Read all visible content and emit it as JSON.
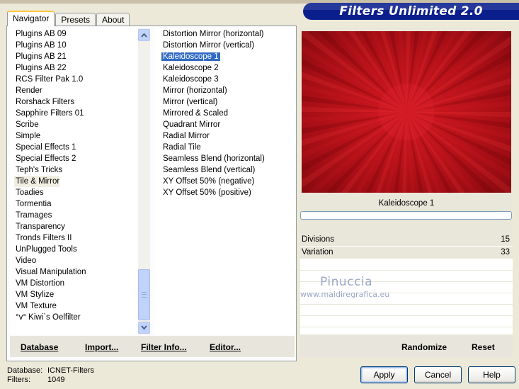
{
  "app": {
    "title": "Filters Unlimited 2.0"
  },
  "tabs": [
    {
      "label": "Navigator",
      "active": true
    },
    {
      "label": "Presets"
    },
    {
      "label": "About"
    }
  ],
  "categories": {
    "items": [
      "Plugins AB 09",
      "Plugins AB 10",
      "Plugins AB 21",
      "Plugins AB 22",
      "RCS Filter Pak 1.0",
      "Render",
      "Rorshack Filters",
      "Sapphire Filters 01",
      "Scribe",
      "Simple",
      "Special Effects 1",
      "Special Effects 2",
      "Teph's Tricks",
      "Tile & Mirror",
      "Toadies",
      "Tormentia",
      "Tramages",
      "Transparency",
      "Tronds Filters II",
      "UnPlugged Tools",
      "Video",
      "Visual Manipulation",
      "VM Distortion",
      "VM Stylize",
      "VM Texture",
      "°v° Kiwi`s Oelfilter"
    ],
    "selected": "Tile & Mirror"
  },
  "filters": {
    "items": [
      "Distortion Mirror (horizontal)",
      "Distortion Mirror (vertical)",
      "Kaleidoscope 1",
      "Kaleidoscope 2",
      "Kaleidoscope 3",
      "Mirror (horizontal)",
      "Mirror (vertical)",
      "Mirrored & Scaled",
      "Quadrant Mirror",
      "Radial Mirror",
      "Radial Tile",
      "Seamless Blend (horizontal)",
      "Seamless Blend (vertical)",
      "XY Offset 50% (negative)",
      "XY Offset 50% (positive)"
    ],
    "selected": "Kaleidoscope 1"
  },
  "left_actions": {
    "database": "Database",
    "import": "Import...",
    "filter_info": "Filter Info...",
    "editor": "Editor..."
  },
  "preview": {
    "filter_name": "Kaleidoscope 1",
    "colors": {
      "center": "#d11922",
      "dark": "#850a10"
    },
    "progress": 0
  },
  "params": [
    {
      "name": "Divisions",
      "value": "15"
    },
    {
      "name": "Variation",
      "value": "33"
    }
  ],
  "watermark": {
    "name": "Pinuccia",
    "url": "www.maidiregrafica.eu"
  },
  "right_actions": {
    "randomize": "Randomize",
    "reset": "Reset"
  },
  "status": {
    "database_label": "Database:",
    "database_value": "ICNET-Filters",
    "filters_label": "Filters:",
    "filters_value": "1049"
  },
  "buttons": {
    "apply": "Apply",
    "cancel": "Cancel",
    "help": "Help"
  },
  "colors": {
    "banner": "#0a1e8c",
    "selection": "#316AC5",
    "window": "#ECE9D8"
  }
}
